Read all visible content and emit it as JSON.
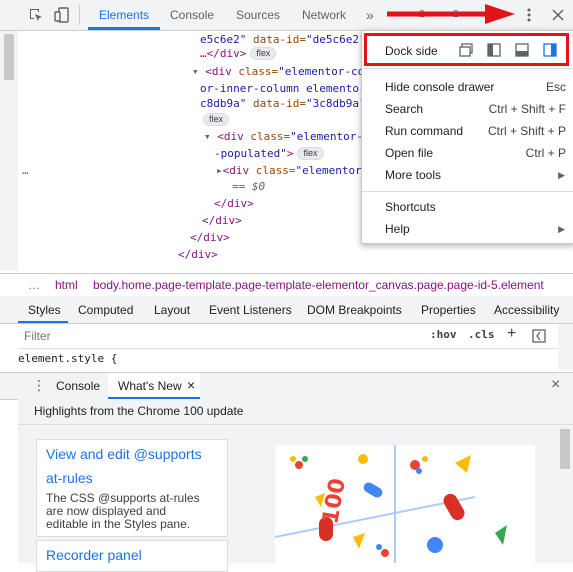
{
  "toolbar": {
    "tabs": [
      "Elements",
      "Console",
      "Sources",
      "Network"
    ],
    "more_tabs": "»",
    "errors_count": "2",
    "issues_count": "2"
  },
  "dom_lines": {
    "l1a": "e5c6e2\"",
    "l1b": " data-id=",
    "l1c": "\"de5c6e2\"",
    "l2": "…</div>",
    "l2chip": "flex",
    "l3tag": "<div",
    "l3an": " class=",
    "l3av": "\"elementor-co",
    "l4": "or-inner-column elementor",
    "l5a": "c8db9a\"",
    "l5b": " data-id=",
    "l5c": "\"3c8db9a\"",
    "l6chip": "flex",
    "l7tag": "<div",
    "l7an": " class=",
    "l7av": "\"elementor-",
    "l8av": "-populated\"",
    "l8tag": ">",
    "l8chip": "flex",
    "l9tag": "<div",
    "l9an": " class=",
    "l9av": "\"elementor",
    "l10": "== $0",
    "l11": "</div>",
    "l12": "</div>",
    "l13": "</div>",
    "l14": "</div>",
    "ellipsis": "…"
  },
  "breadcrumb": {
    "dots": "…",
    "html": "html",
    "body": "body.home.page-template.page-template-elementor_canvas.page.page-id-5.element"
  },
  "styles_tabs": [
    "Styles",
    "Computed",
    "Layout",
    "Event Listeners",
    "DOM Breakpoints",
    "Properties",
    "Accessibility"
  ],
  "filter": {
    "placeholder": "Filter",
    "hov": ":hov",
    "cls": ".cls",
    "plus": "+"
  },
  "element_style": "element.style {",
  "drawer": {
    "tabs": [
      "Console",
      "What's New"
    ],
    "close_tab": "×",
    "close": "×",
    "kebab": "⋮"
  },
  "whats_new": {
    "header": "Highlights from the Chrome 100 update",
    "card1_title_1": "View and edit @supports",
    "card1_title_2": "at-rules",
    "card1_body_1": "The CSS @supports at-rules",
    "card1_body_2": "are now displayed and",
    "card1_body_3": "editable in the Styles pane.",
    "card2_title": "Recorder panel",
    "graphic_text": "100"
  },
  "menu": {
    "dock_side": "Dock side",
    "items": [
      {
        "label": "Hide console drawer",
        "shortcut": "Esc"
      },
      {
        "label": "Search",
        "shortcut": "Ctrl + Shift + F"
      },
      {
        "label": "Run command",
        "shortcut": "Ctrl + Shift + P"
      },
      {
        "label": "Open file",
        "shortcut": "Ctrl + P"
      },
      {
        "label": "More tools",
        "shortcut": ""
      },
      {
        "label": "Shortcuts",
        "shortcut": ""
      },
      {
        "label": "Help",
        "shortcut": ""
      }
    ]
  },
  "colors": {
    "accent": "#1a73e8",
    "annotation_red": "#e3131a",
    "error": "#d93025",
    "issues": "#1a73e8"
  },
  "icons": [
    "inspect-icon",
    "device-toolbar-icon",
    "kebab-menu-icon",
    "close-icon",
    "undock-icon",
    "dock-left-icon",
    "dock-bottom-icon",
    "dock-right-icon",
    "submenu-arrow-icon",
    "red-arrow-annotation"
  ]
}
